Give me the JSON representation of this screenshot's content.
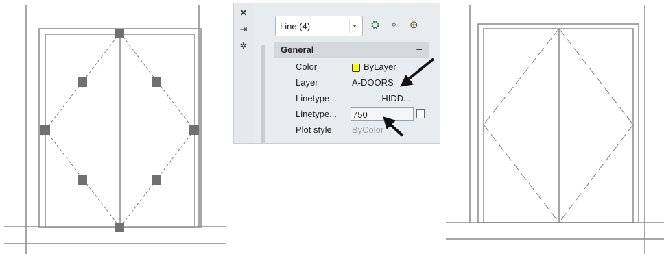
{
  "properties": {
    "toolbar_icons": [
      "close-icon",
      "auto-hide-icon",
      "properties-icon"
    ],
    "selection": "Line (4)",
    "header_icons": [
      "quick-select-icon",
      "select-objects-icon",
      "toggle-pickadd-icon"
    ],
    "section": {
      "title": "General",
      "collapse_glyph": "–"
    },
    "rows": [
      {
        "label": "Color",
        "value": "ByLayer",
        "swatch_color": "#ffff00"
      },
      {
        "label": "Layer",
        "value": "A-DOORS"
      },
      {
        "label": "Linetype",
        "value": "– – – –  HIDD..."
      },
      {
        "label": "Linetype...",
        "value": "750"
      },
      {
        "label": "Plot style",
        "value": "ByColor"
      }
    ]
  }
}
